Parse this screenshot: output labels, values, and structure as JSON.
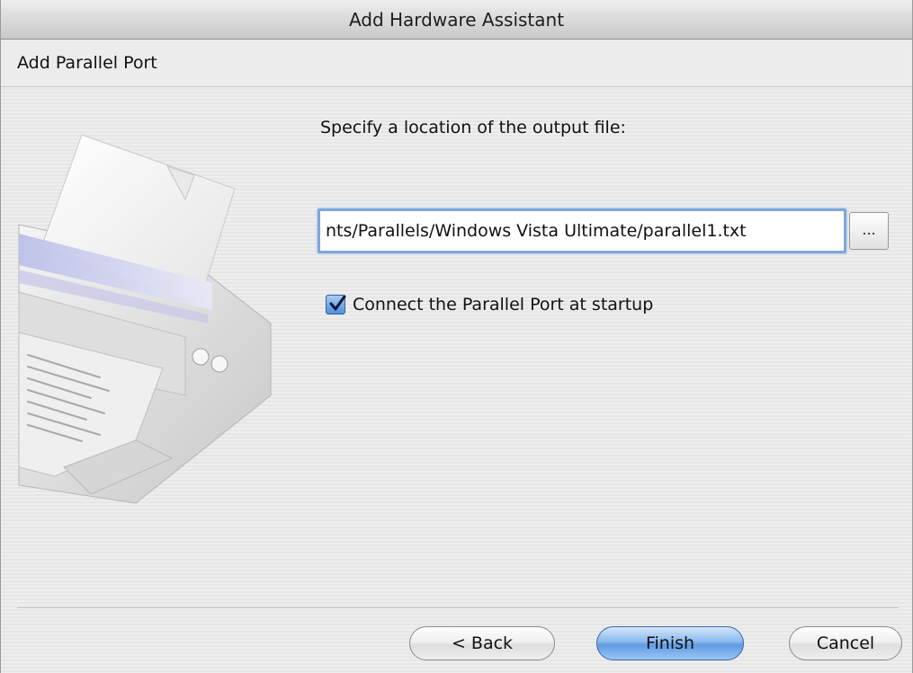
{
  "window": {
    "title": "Add Hardware Assistant"
  },
  "header": {
    "title": "Add Parallel Port"
  },
  "illustration": {
    "icon": "printer-icon"
  },
  "form": {
    "prompt": "Specify a location of the output file:",
    "path_value": "nts/Parallels/Windows Vista Ultimate/parallel1.txt",
    "browse_label": "...",
    "connect_checkbox": {
      "label": "Connect the Parallel Port at startup",
      "checked": true
    }
  },
  "footer": {
    "back_label": "< Back",
    "finish_label": "Finish",
    "cancel_label": "Cancel"
  },
  "colors": {
    "accent": "#5f9be4",
    "focus_ring": "#7fa6db"
  }
}
